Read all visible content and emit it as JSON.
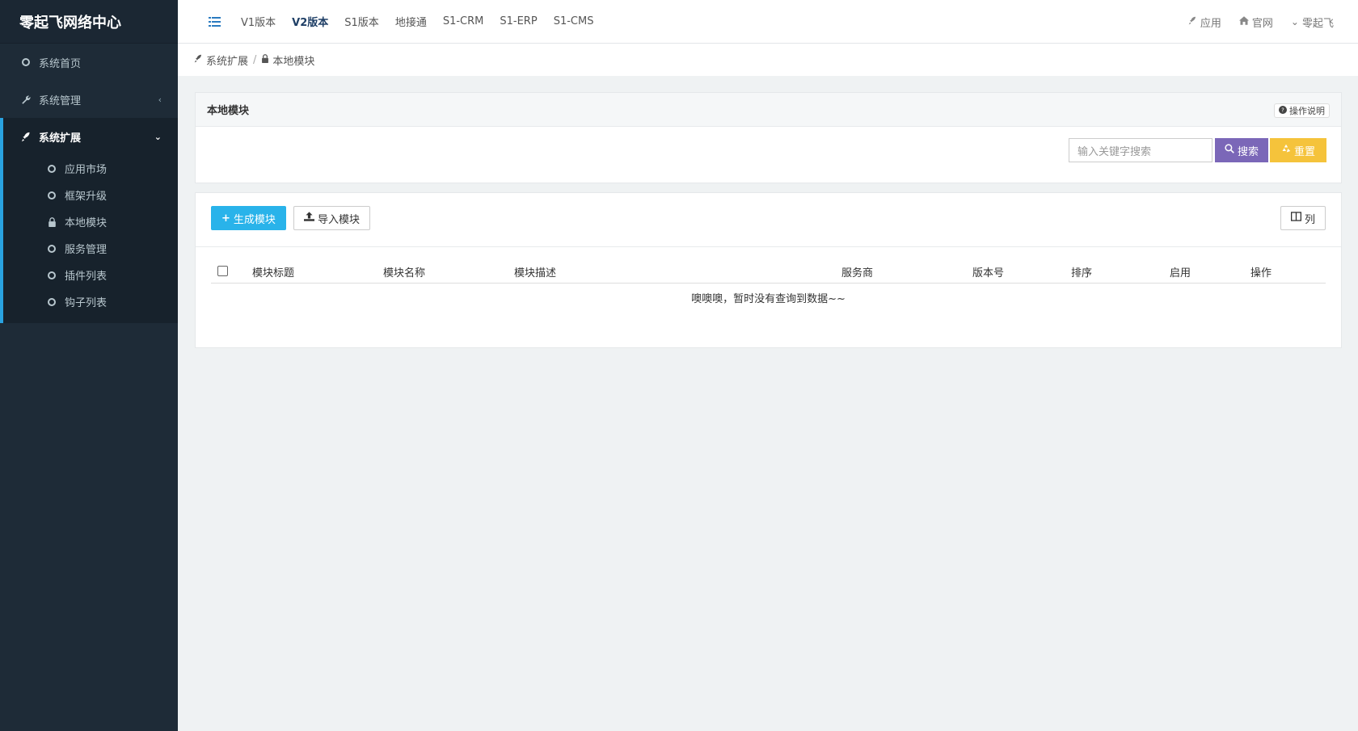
{
  "brand": "零起飞网络中心",
  "sidebar": {
    "items": [
      {
        "label": "系统首页",
        "icon": "circle-icon"
      },
      {
        "label": "系统管理",
        "icon": "wrench-icon"
      }
    ],
    "group": {
      "label": "系统扩展",
      "icon": "rocket-icon",
      "children": [
        {
          "label": "应用市场",
          "icon": "circle-icon"
        },
        {
          "label": "框架升级",
          "icon": "circle-icon"
        },
        {
          "label": "本地模块",
          "icon": "lock-icon"
        },
        {
          "label": "服务管理",
          "icon": "circle-icon"
        },
        {
          "label": "插件列表",
          "icon": "circle-icon"
        },
        {
          "label": "钩子列表",
          "icon": "circle-icon"
        }
      ]
    }
  },
  "topbar": {
    "tabs": [
      "V1版本",
      "V2版本",
      "S1版本",
      "地接通",
      "S1-CRM",
      "S1-ERP",
      "S1-CMS"
    ],
    "active_tab": "V2版本",
    "right": {
      "app": "应用",
      "site": "官网",
      "user": "零起飞"
    }
  },
  "breadcrumb": {
    "parent": "系统扩展",
    "current": "本地模块"
  },
  "search_panel": {
    "title": "本地模块",
    "help": "操作说明",
    "search_placeholder": "输入关键字搜索",
    "search_button": "搜索",
    "reset_button": "重置"
  },
  "table_panel": {
    "create_button": "生成模块",
    "import_button": "导入模块",
    "columns_button": "列",
    "headers": [
      "模块标题",
      "模块名称",
      "模块描述",
      "服务商",
      "版本号",
      "排序",
      "启用",
      "操作"
    ],
    "empty_text": "噢噢噢，暂时没有查询到数据~~"
  },
  "colors": {
    "sidebar_bg": "#1e2b37",
    "accent_blue": "#29b3ea",
    "search_purple": "#7b67b8",
    "reset_yellow": "#f5c33b",
    "active_border": "#29a3e1"
  }
}
